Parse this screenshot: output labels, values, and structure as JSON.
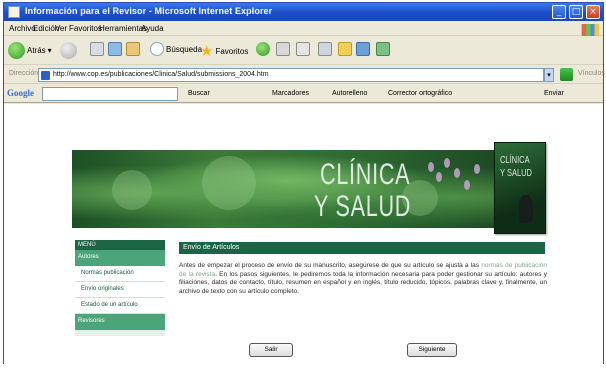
{
  "window": {
    "title": "Información para el Revisor - Microsoft Internet Explorer"
  },
  "menu": [
    "Archivo",
    "Edición",
    "Ver",
    "Favoritos",
    "Herramientas",
    "Ayuda"
  ],
  "toolbar": {
    "back_label": "Atrás",
    "search_label": "Búsqueda",
    "favorites_label": "Favoritos"
  },
  "address": {
    "label": "Dirección",
    "url": "http://www.cop.es/publicaciones/Clinica/Salud/submissions_2004.htm",
    "links_label": "Vínculos"
  },
  "google": {
    "logo": "Google",
    "query": "",
    "items": [
      "Buscar",
      "Marcadores",
      "Autorelleno",
      "Corrector ortográfico",
      "Enviar"
    ]
  },
  "banner": {
    "word1": "CLÍNICA",
    "word2": "Y SALUD",
    "cover_word1": "CLÍNICA",
    "cover_word2": "Y SALUD"
  },
  "sidebar": {
    "header": "MENÚ",
    "items": [
      {
        "label": "Autores",
        "kind": "section"
      },
      {
        "label": "Normas publicación",
        "kind": "link"
      },
      {
        "label": "Envío originales",
        "kind": "link"
      },
      {
        "label": "Estado de un artículo",
        "kind": "link"
      },
      {
        "label": "Revisores",
        "kind": "section"
      }
    ]
  },
  "content": {
    "title": "Envío de Artículos",
    "paragraph_a": "Antes de empezar el proceso de envío de su manuscrito, asegúrese de que su artículo se ajusta a las",
    "paragraph_link": "normas de publicación de la revista",
    "paragraph_b": ". En los pasos siguientes, le pediremos toda la información necesaria para poder gestionar su artículo: autores y filiaciones, datos de contacto, título, resumen en español y en inglés, título reducido, tópicos, palabras clave y, finalmente, un archivo de texto con su artículo completo."
  },
  "buttons": {
    "back": "Salir",
    "next": "Siguiente"
  },
  "colors": {
    "title_bar": "#1d4fcc",
    "chrome": "#ece9d8",
    "accent_green": "#1c6446",
    "section_green": "#4ba57a"
  }
}
